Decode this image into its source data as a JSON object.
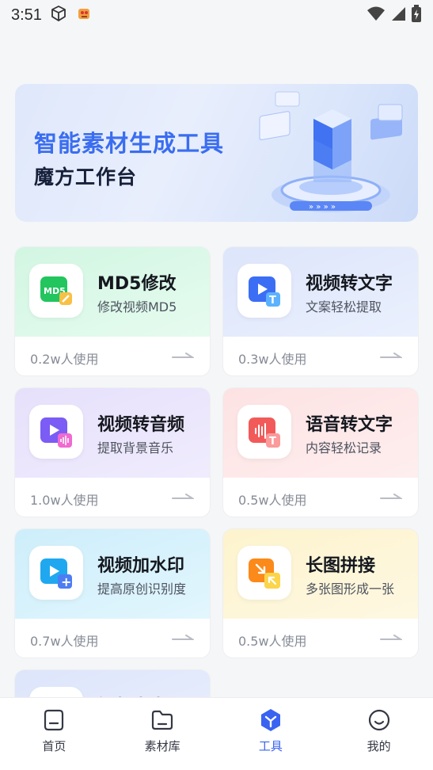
{
  "status_bar": {
    "time": "3:51"
  },
  "banner": {
    "title": "智能素材生成工具",
    "subtitle": "魔方工作台"
  },
  "tools": [
    {
      "name": "MD5修改",
      "desc": "修改视频MD5",
      "usage": "0.2w人使用",
      "icon": "md5-edit-icon",
      "theme": "green",
      "icon_text": "MD5"
    },
    {
      "name": "视频转文字",
      "desc": "文案轻松提取",
      "usage": "0.3w人使用",
      "icon": "video-to-text-icon",
      "theme": "blue",
      "icon_text": "T"
    },
    {
      "name": "视频转音频",
      "desc": "提取背景音乐",
      "usage": "1.0w人使用",
      "icon": "video-to-audio-icon",
      "theme": "purple"
    },
    {
      "name": "语音转文字",
      "desc": "内容轻松记录",
      "usage": "0.5w人使用",
      "icon": "speech-to-text-icon",
      "theme": "red",
      "icon_text": "T"
    },
    {
      "name": "视频加水印",
      "desc": "提高原创识别度",
      "usage": "0.7w人使用",
      "icon": "video-watermark-icon",
      "theme": "cyan",
      "icon_text": "+"
    },
    {
      "name": "长图拼接",
      "desc": "多张图形成一张",
      "usage": "0.5w人使用",
      "icon": "image-stitch-icon",
      "theme": "yellow"
    },
    {
      "name": "视频去水印",
      "desc": "",
      "usage": "",
      "icon": "video-remove-watermark-icon",
      "theme": "blue"
    }
  ],
  "nav": [
    {
      "label": "首页",
      "icon": "home-icon",
      "active": false
    },
    {
      "label": "素材库",
      "icon": "folder-icon",
      "active": false
    },
    {
      "label": "工具",
      "icon": "tools-icon",
      "active": true
    },
    {
      "label": "我的",
      "icon": "profile-icon",
      "active": false
    }
  ],
  "colors": {
    "accent": "#3a63f2",
    "banner_title": "#3a6df0"
  }
}
